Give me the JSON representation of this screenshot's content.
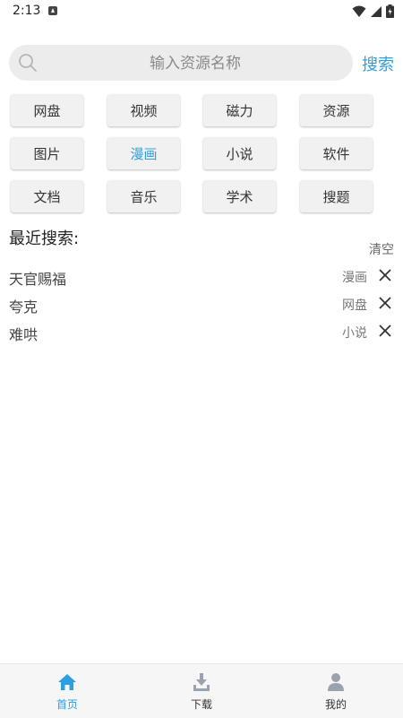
{
  "status_bar": {
    "time": "2:13"
  },
  "search": {
    "placeholder": "输入资源名称",
    "button_label": "搜索"
  },
  "categories": [
    {
      "label": "网盘"
    },
    {
      "label": "视频"
    },
    {
      "label": "磁力"
    },
    {
      "label": "资源"
    },
    {
      "label": "图片"
    },
    {
      "label": "漫画"
    },
    {
      "label": "小说"
    },
    {
      "label": "软件"
    },
    {
      "label": "文档"
    },
    {
      "label": "音乐"
    },
    {
      "label": "学术"
    },
    {
      "label": "搜题"
    }
  ],
  "active_category": "漫画",
  "recent": {
    "title": "最近搜索:",
    "clear_label": "清空",
    "items": [
      {
        "query": "天官赐福",
        "category": "漫画"
      },
      {
        "query": "夸克",
        "category": "网盘"
      },
      {
        "query": "难哄",
        "category": "小说"
      }
    ]
  },
  "bottom_nav": {
    "items": [
      {
        "label": "首页",
        "icon": "home-icon"
      },
      {
        "label": "下载",
        "icon": "download-icon"
      },
      {
        "label": "我的",
        "icon": "profile-icon"
      }
    ],
    "active": "首页"
  },
  "colors": {
    "accent": "#2e9fe0",
    "inactive_icon": "#9aa3ad"
  }
}
